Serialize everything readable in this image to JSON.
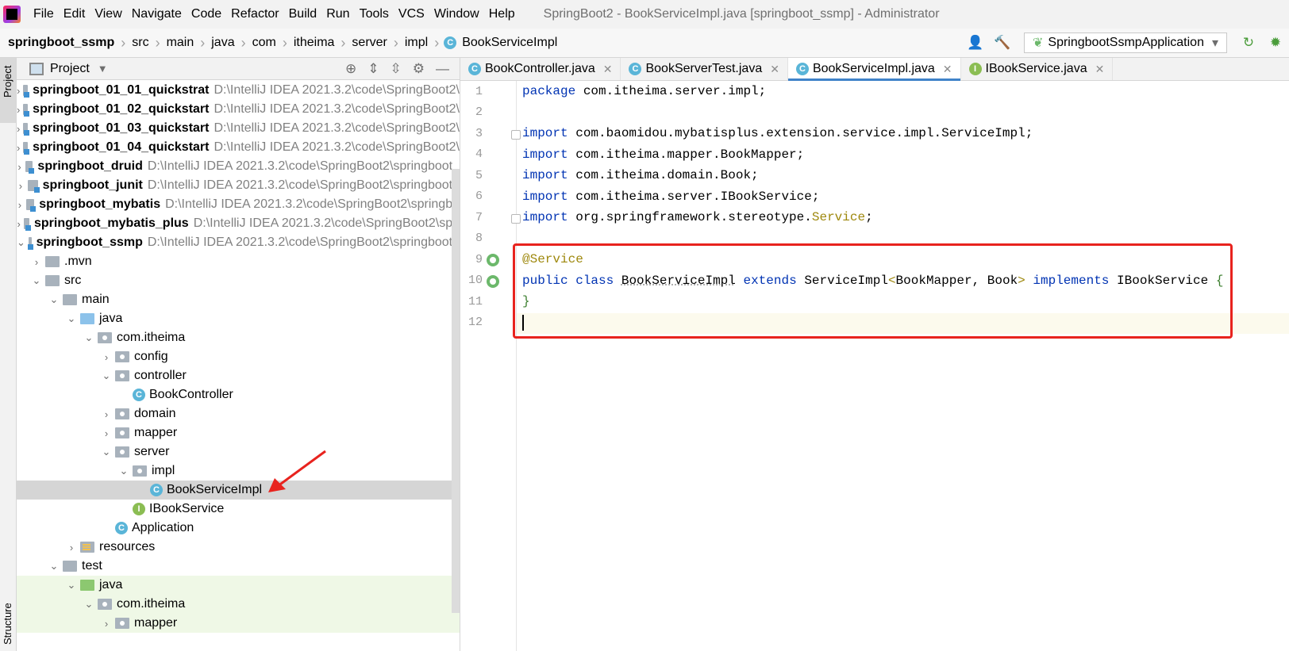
{
  "menubar": {
    "items": [
      "File",
      "Edit",
      "View",
      "Navigate",
      "Code",
      "Refactor",
      "Build",
      "Run",
      "Tools",
      "VCS",
      "Window",
      "Help"
    ],
    "window_title": "SpringBoot2 - BookServiceImpl.java [springboot_ssmp] - Administrator"
  },
  "navbar": {
    "breadcrumb": [
      "springboot_ssmp",
      "src",
      "main",
      "java",
      "com",
      "itheima",
      "server",
      "impl",
      "BookServiceImpl"
    ],
    "run_config": "SpringbootSsmpApplication"
  },
  "sidebar": {
    "project_tab": "Project",
    "structure_tab": "Structure"
  },
  "project": {
    "title": "Project",
    "tree": [
      {
        "label": "springboot_01_01_quickstrat",
        "path": "D:\\IntelliJ IDEA 2021.3.2\\code\\SpringBoot2\\"
      },
      {
        "label": "springboot_01_02_quickstart",
        "path": "D:\\IntelliJ IDEA 2021.3.2\\code\\SpringBoot2\\"
      },
      {
        "label": "springboot_01_03_quickstart",
        "path": "D:\\IntelliJ IDEA 2021.3.2\\code\\SpringBoot2\\"
      },
      {
        "label": "springboot_01_04_quickstart",
        "path": "D:\\IntelliJ IDEA 2021.3.2\\code\\SpringBoot2\\"
      },
      {
        "label": "springboot_druid",
        "path": "D:\\IntelliJ IDEA 2021.3.2\\code\\SpringBoot2\\springboot_"
      },
      {
        "label": "springboot_junit",
        "path": "D:\\IntelliJ IDEA 2021.3.2\\code\\SpringBoot2\\springboot_"
      },
      {
        "label": "springboot_mybatis",
        "path": "D:\\IntelliJ IDEA 2021.3.2\\code\\SpringBoot2\\springbo"
      },
      {
        "label": "springboot_mybatis_plus",
        "path": "D:\\IntelliJ IDEA 2021.3.2\\code\\SpringBoot2\\spri"
      },
      {
        "label": "springboot_ssmp",
        "path": "D:\\IntelliJ IDEA 2021.3.2\\code\\SpringBoot2\\springboot_"
      },
      {
        "label": ".mvn"
      },
      {
        "label": "src"
      },
      {
        "label": "main"
      },
      {
        "label": "java"
      },
      {
        "label": "com.itheima"
      },
      {
        "label": "config"
      },
      {
        "label": "controller"
      },
      {
        "label": "BookController"
      },
      {
        "label": "domain"
      },
      {
        "label": "mapper"
      },
      {
        "label": "server"
      },
      {
        "label": "impl"
      },
      {
        "label": "BookServiceImpl"
      },
      {
        "label": "IBookService"
      },
      {
        "label": "Application"
      },
      {
        "label": "resources"
      },
      {
        "label": "test"
      },
      {
        "label": "java"
      },
      {
        "label": "com.itheima"
      },
      {
        "label": "mapper"
      }
    ]
  },
  "editor": {
    "tabs": [
      {
        "label": "BookController.java"
      },
      {
        "label": "BookServerTest.java"
      },
      {
        "label": "BookServiceImpl.java",
        "active": true
      },
      {
        "label": "IBookService.java"
      }
    ],
    "line_numbers": [
      "1",
      "2",
      "3",
      "4",
      "5",
      "6",
      "7",
      "8",
      "9",
      "10",
      "11",
      "12"
    ],
    "code": {
      "l1_kw": "package",
      "l1_rest": " com.itheima.server.impl;",
      "l3_kw": "import",
      "l3_rest": " com.baomidou.mybatisplus.extension.service.impl.ServiceImpl;",
      "l4_kw": "import",
      "l4_rest": " com.itheima.mapper.BookMapper;",
      "l5_kw": "import",
      "l5_rest": " com.itheima.domain.Book;",
      "l6_kw": "import",
      "l6_rest": " com.itheima.server.IBookService;",
      "l7_kw": "import",
      "l7_rest": " org.springframework.stereotype.",
      "l7_svc": "Service",
      "l7_end": ";",
      "l9_ann": "@Service",
      "l10_public": "public",
      "l10_class": "class",
      "l10_name": "BookServiceImpl",
      "l10_extends": "extends",
      "l10_base": "ServiceImpl",
      "l10_lt": "<",
      "l10_generics": "BookMapper, Book",
      "l10_gt": ">",
      "l10_implements": "implements",
      "l10_iface": "IBookService",
      "l10_brace": "{",
      "l11_brace": "}"
    }
  }
}
